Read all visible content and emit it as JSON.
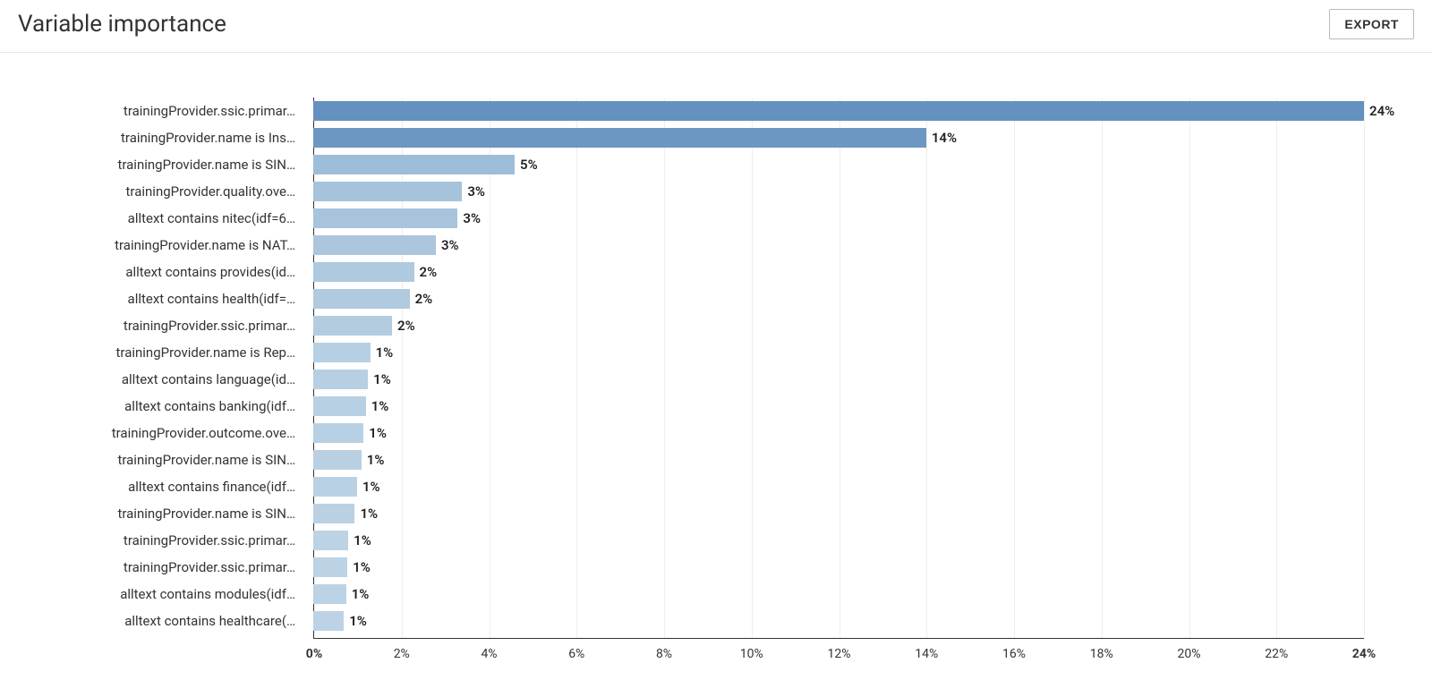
{
  "header": {
    "title": "Variable importance",
    "export_label": "EXPORT"
  },
  "chart_data": {
    "type": "bar",
    "title": "Variable importance",
    "xlabel": "",
    "ylabel": "",
    "xlim": [
      0,
      24
    ],
    "x_ticks": [
      0,
      2,
      4,
      6,
      8,
      10,
      12,
      14,
      16,
      18,
      20,
      22,
      24
    ],
    "x_tick_labels": [
      "0%",
      "2%",
      "4%",
      "6%",
      "8%",
      "10%",
      "12%",
      "14%",
      "16%",
      "18%",
      "20%",
      "22%",
      "24%"
    ],
    "categories": [
      "trainingProvider.ssic.primar…",
      "trainingProvider.name is Ins…",
      "trainingProvider.name is SIN…",
      "trainingProvider.quality.ove…",
      "alltext contains nitec(idf=6…",
      "trainingProvider.name is NAT…",
      "alltext contains provides(id…",
      "alltext contains health(idf=…",
      "trainingProvider.ssic.primar…",
      "trainingProvider.name is Rep…",
      "alltext contains language(id…",
      "alltext contains banking(idf…",
      "trainingProvider.outcome.ove…",
      "trainingProvider.name is SIN…",
      "alltext contains finance(idf…",
      "trainingProvider.name is SIN…",
      "trainingProvider.ssic.primar…",
      "trainingProvider.ssic.primar…",
      "alltext contains modules(idf…",
      "alltext contains healthcare(…"
    ],
    "values": [
      24,
      14,
      5,
      3,
      3,
      3,
      2,
      2,
      2,
      1,
      1,
      1,
      1,
      1,
      1,
      1,
      1,
      1,
      1,
      1
    ],
    "bar_values_exact": [
      24,
      14,
      4.6,
      3.4,
      3.3,
      2.8,
      2.3,
      2.2,
      1.8,
      1.3,
      1.25,
      1.2,
      1.15,
      1.1,
      1.0,
      0.95,
      0.8,
      0.78,
      0.75,
      0.7
    ],
    "value_labels": [
      "24%",
      "14%",
      "5%",
      "3%",
      "3%",
      "3%",
      "2%",
      "2%",
      "2%",
      "1%",
      "1%",
      "1%",
      "1%",
      "1%",
      "1%",
      "1%",
      "1%",
      "1%",
      "1%",
      "1%"
    ],
    "bar_colors": [
      "#6491bf",
      "#6c97c3",
      "#9ebdd8",
      "#a7c3db",
      "#a8c4dc",
      "#abc6dd",
      "#afc9df",
      "#b0cadf",
      "#b3cce0",
      "#b7cfe2",
      "#b7cfe2",
      "#b8d0e3",
      "#b8d0e3",
      "#b9d0e3",
      "#bad1e4",
      "#bad1e4",
      "#bcd3e5",
      "#bcd3e5",
      "#bcd3e5",
      "#bdd3e5"
    ]
  }
}
